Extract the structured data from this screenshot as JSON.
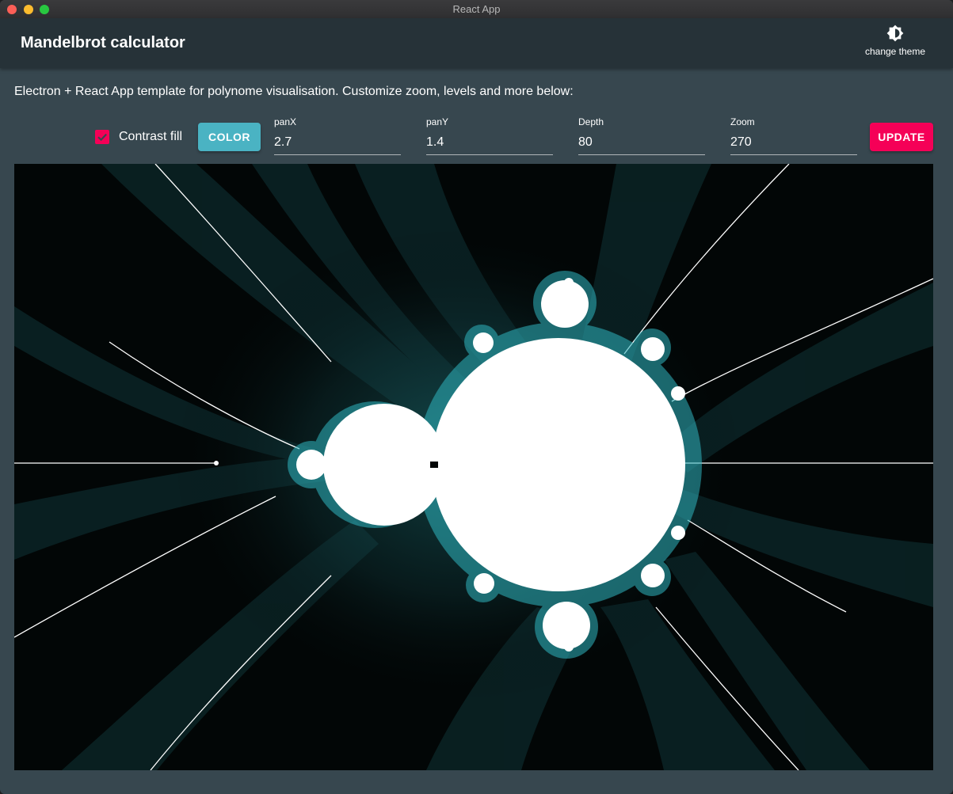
{
  "window": {
    "title": "React App"
  },
  "appbar": {
    "title": "Mandelbrot calculator",
    "theme_button": {
      "label": "change theme",
      "icon": "brightness-icon"
    }
  },
  "description": "Electron + React App template for polynome visualisation. Customize zoom, levels and more below:",
  "controls": {
    "contrast_fill": {
      "label": "Contrast fill",
      "checked": true
    },
    "color_button": {
      "label": "COLOR"
    },
    "panX": {
      "label": "panX",
      "value": "2.7"
    },
    "panY": {
      "label": "panY",
      "value": "1.4"
    },
    "depth": {
      "label": "Depth",
      "value": "80"
    },
    "zoom": {
      "label": "Zoom",
      "value": "270"
    },
    "update_button": {
      "label": "UPDATE"
    }
  },
  "colors": {
    "appbar": "#263238",
    "background": "#37474f",
    "accent_pink": "#f50057",
    "accent_teal": "#4ab3c3",
    "fractal_background": "#020606",
    "fractal_edge": "#2fb5bf",
    "fractal_set": "#ffffff"
  }
}
